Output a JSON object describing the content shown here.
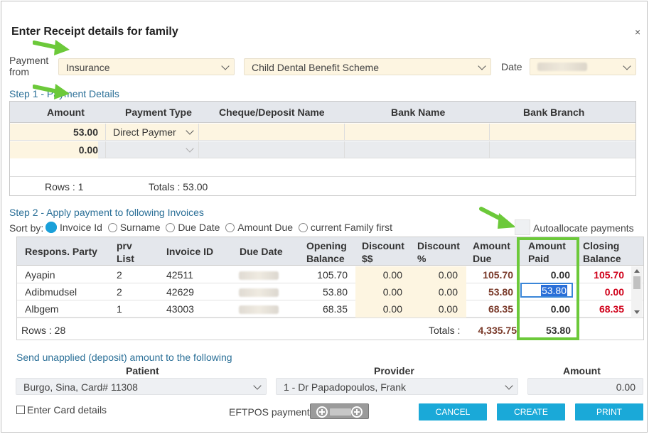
{
  "dialog": {
    "title": "Enter Receipt details for family",
    "close": "×"
  },
  "payment_from": {
    "label_line1": "Payment",
    "label_line2": "from",
    "source": "Insurance",
    "scheme": "Child Dental Benefit Scheme",
    "date_label": "Date"
  },
  "step1": {
    "title": "Step 1 - Payment Details",
    "headers": [
      "Amount",
      "Payment Type",
      "Cheque/Deposit Name",
      "Bank Name",
      "Bank Branch"
    ],
    "rows": [
      {
        "amount": "53.00",
        "type": "Direct Paymer"
      },
      {
        "amount": "0.00",
        "type": ""
      }
    ],
    "rows_label": "Rows : 1",
    "totals_label": "Totals : 53.00"
  },
  "step2": {
    "title": "Step 2 - Apply payment to following Invoices",
    "sort_label": "Sort by:",
    "sort_options": [
      "Invoice Id",
      "Surname",
      "Due Date",
      "Amount Due",
      "current Family first"
    ],
    "autoallocate": "Autoallocate payments",
    "headers": {
      "party": "Respons. Party",
      "prv_1": "prv",
      "prv_2": "List",
      "invoice": "Invoice ID",
      "due_date": "Due Date",
      "open_1": "Opening",
      "open_2": "Balance",
      "disc_1": "Discount",
      "disc_2": "$$",
      "discp_1": "Discount",
      "discp_2": "%",
      "amt_1": "Amount",
      "amt_2": "Due",
      "paid_1": "Amount",
      "paid_2": "Paid",
      "close_1": "Closing",
      "close_2": "Balance"
    },
    "rows": [
      {
        "party": "Ayapin",
        "prv": "2",
        "invoice": "42511",
        "opening": "105.70",
        "disc": "0.00",
        "discp": "0.00",
        "due": "105.70",
        "paid": "0.00",
        "closing": "105.70"
      },
      {
        "party": "Adibmudsel",
        "prv": "2",
        "invoice": "42629",
        "opening": "53.80",
        "disc": "0.00",
        "discp": "0.00",
        "due": "53.80",
        "paid": "53.80",
        "closing": "0.00"
      },
      {
        "party": "Albgem",
        "prv": "1",
        "invoice": "43003",
        "opening": "68.35",
        "disc": "0.00",
        "discp": "0.00",
        "due": "68.35",
        "paid": "0.00",
        "closing": "68.35"
      }
    ],
    "rows_label": "Rows : 28",
    "totals_label": "Totals :",
    "total_due": "4,335.75",
    "total_paid": "53.80"
  },
  "unapplied": {
    "title": "Send unapplied (deposit) amount to the following",
    "patient_label": "Patient",
    "provider_label": "Provider",
    "amount_label": "Amount",
    "patient": "Burgo, Sina, Card# 11308",
    "provider": "1 - Dr Papadopoulos, Frank",
    "amount": "0.00"
  },
  "footer": {
    "card_details": "Enter Card details",
    "eftpos": "EFTPOS payment",
    "cancel": "CANCEL",
    "create": "CREATE",
    "print": "PRINT"
  },
  "colors": {
    "accent": "#1aa9d8",
    "highlight": "#6cc93a",
    "field_bg": "#fdf5e1",
    "negative": "#d0021b"
  }
}
